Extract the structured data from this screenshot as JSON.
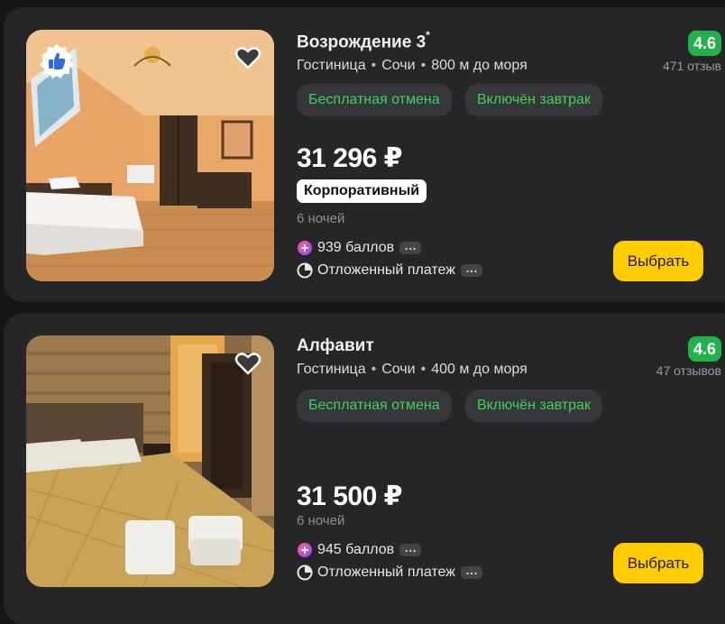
{
  "hotels": [
    {
      "name": "Возрождение 3",
      "stars": "*",
      "type": "Гостиница",
      "city": "Сочи",
      "distance": "800 м до моря",
      "rating": "4.6",
      "reviews": "471 отзыв",
      "tags": [
        "Бесплатная отмена",
        "Включён завтрак"
      ],
      "price": "31 296 ₽",
      "badge": "Корпоративный",
      "nights": "6 ночей",
      "bonus": "939 баллов",
      "deferred_payment": "Отложенный платеж",
      "button": "Выбрать",
      "photo_icon": "bedroom-photo",
      "liked_badge_icon": "thumbs-up-icon"
    },
    {
      "name": "Алфавит",
      "type": "Гостиница",
      "city": "Сочи",
      "distance": "400 м до моря",
      "rating": "4.6",
      "reviews": "47 отзывов",
      "tags": [
        "Бесплатная отмена",
        "Включён завтрак"
      ],
      "price": "31 500 ₽",
      "nights": "6 ночей",
      "bonus": "945 баллов",
      "deferred_payment": "Отложенный платеж",
      "button": "Выбрать",
      "photo_icon": "bedroom-photo"
    }
  ],
  "colors": {
    "background": "#161616",
    "card": "#262629",
    "tag_bg": "#37373b",
    "tag_text": "#3fd158",
    "rating_bg": "#22b24c",
    "button": "#ffcc00"
  }
}
